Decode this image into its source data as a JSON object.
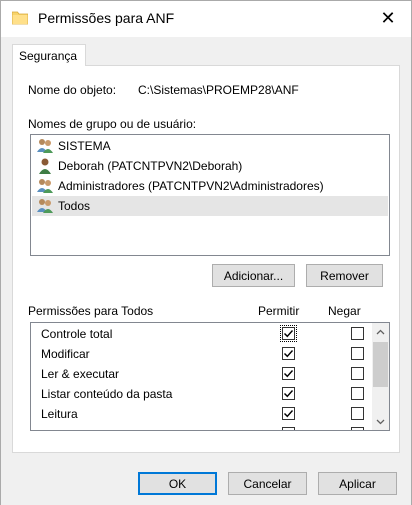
{
  "window": {
    "title": "Permissões para ANF",
    "close_glyph": "✕"
  },
  "tabs": [
    {
      "label": "Segurança",
      "selected": true
    }
  ],
  "object": {
    "label": "Nome do objeto:",
    "value": "C:\\Sistemas\\PROEMP28\\ANF"
  },
  "users": {
    "label": "Nomes de grupo ou de usuário:",
    "items": [
      {
        "name": "SISTEMA",
        "icon": "group-icon",
        "selected": false
      },
      {
        "name": "Deborah (PATCNTPVN2\\Deborah)",
        "icon": "user-icon",
        "selected": false
      },
      {
        "name": "Administradores (PATCNTPVN2\\Administradores)",
        "icon": "group-icon",
        "selected": false
      },
      {
        "name": "Todos",
        "icon": "group-icon",
        "selected": true
      }
    ],
    "add_label": "Adicionar...",
    "remove_label": "Remover"
  },
  "permissions": {
    "header": "Permissões para Todos",
    "allow_header": "Permitir",
    "deny_header": "Negar",
    "rows": [
      {
        "name": "Controle total",
        "allow": true,
        "deny": false
      },
      {
        "name": "Modificar",
        "allow": true,
        "deny": false
      },
      {
        "name": "Ler & executar",
        "allow": true,
        "deny": false
      },
      {
        "name": "Listar conteúdo da pasta",
        "allow": true,
        "deny": false
      },
      {
        "name": "Leitura",
        "allow": true,
        "deny": false
      },
      {
        "name": "",
        "allow": false,
        "deny": false
      }
    ]
  },
  "buttons": {
    "ok": "OK",
    "cancel": "Cancelar",
    "apply": "Aplicar"
  },
  "colors": {
    "accent": "#0078d7",
    "selection": "#e5e5e5",
    "check": "#000000"
  }
}
